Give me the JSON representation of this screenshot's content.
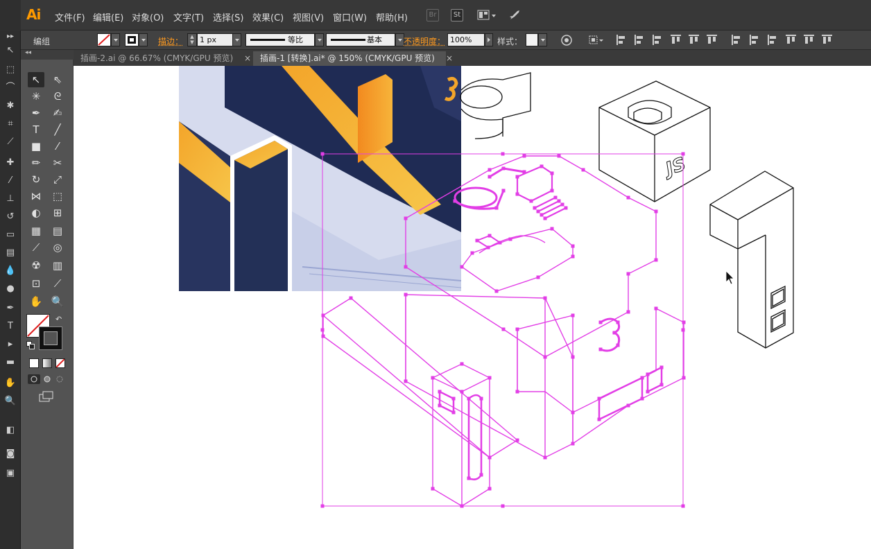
{
  "app": {
    "logo": "Ai",
    "menu": [
      "文件(F)",
      "编辑(E)",
      "对象(O)",
      "文字(T)",
      "选择(S)",
      "效果(C)",
      "视图(V)",
      "窗口(W)",
      "帮助(H)"
    ],
    "menubar_icons": [
      "Br",
      "St",
      "workspace-icon",
      "rocket-icon"
    ]
  },
  "control": {
    "label_group": "编组",
    "stroke_label": "描边：",
    "stroke_value": "1 px",
    "profile_label": "等比",
    "brush_label": "基本",
    "opacity_label": "不透明度：",
    "opacity_value": "100%",
    "style_label": "样式："
  },
  "tabs": [
    {
      "label": "插画-2.ai @ 66.67% (CMYK/GPU 预览)",
      "active": false
    },
    {
      "label": "插画-1 [转换].ai* @ 150% (CMYK/GPU 预览)",
      "active": true
    }
  ],
  "colors": {
    "accent": "#ff9a00",
    "selection": "#e23ee6",
    "navy": "#24315e",
    "orange": "#f5a928"
  },
  "canvas": {
    "logo_letters": "JS",
    "glyph_digit": "3"
  }
}
